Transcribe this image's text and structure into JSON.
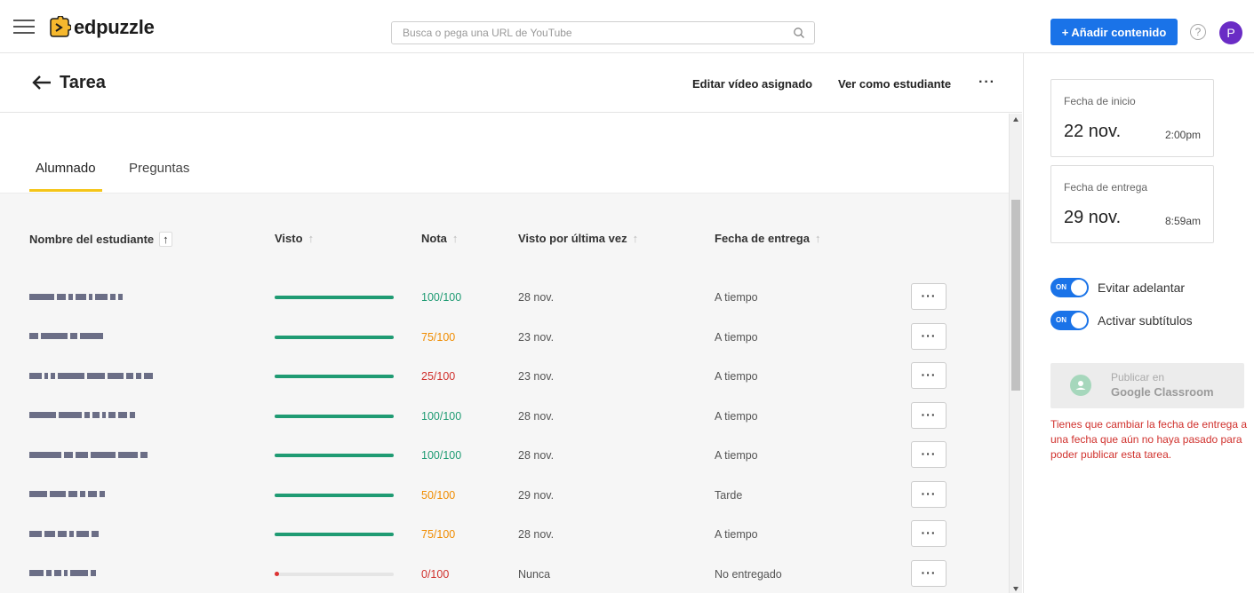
{
  "app": {
    "name": "edpuzzle"
  },
  "search": {
    "placeholder": "Busca o pega una URL de YouTube"
  },
  "header": {
    "add_button": "+ Añadir contenido",
    "help": "?",
    "avatar_initial": "P"
  },
  "page": {
    "title": "Tarea",
    "edit_link": "Editar vídeo asignado",
    "student_view_link": "Ver como estudiante",
    "more": "···"
  },
  "tabs": [
    {
      "label": "Alumnado"
    },
    {
      "label": "Preguntas"
    }
  ],
  "table": {
    "columns": [
      {
        "label": "Nombre del estudiante"
      },
      {
        "label": "Visto"
      },
      {
        "label": "Nota"
      },
      {
        "label": "Visto por última vez"
      },
      {
        "label": "Fecha de entrega"
      }
    ],
    "rows": [
      {
        "progress": 1.0,
        "grade": "100/100",
        "grade_color": "#1f9b73",
        "last_seen": "28 nov.",
        "delivery": "A tiempo"
      },
      {
        "progress": 1.0,
        "grade": "75/100",
        "grade_color": "#f08c00",
        "last_seen": "23 nov.",
        "delivery": "A tiempo"
      },
      {
        "progress": 1.0,
        "grade": "25/100",
        "grade_color": "#d0312d",
        "last_seen": "23 nov.",
        "delivery": "A tiempo"
      },
      {
        "progress": 1.0,
        "grade": "100/100",
        "grade_color": "#1f9b73",
        "last_seen": "28 nov.",
        "delivery": "A tiempo"
      },
      {
        "progress": 1.0,
        "grade": "100/100",
        "grade_color": "#1f9b73",
        "last_seen": "28 nov.",
        "delivery": "A tiempo"
      },
      {
        "progress": 1.0,
        "grade": "50/100",
        "grade_color": "#f08c00",
        "last_seen": "29 nov.",
        "delivery": "Tarde"
      },
      {
        "progress": 1.0,
        "grade": "75/100",
        "grade_color": "#f08c00",
        "last_seen": "28 nov.",
        "delivery": "A tiempo"
      },
      {
        "progress": 0.0,
        "grade": "0/100",
        "grade_color": "#d0312d",
        "last_seen": "Nunca",
        "delivery": "No entregado"
      }
    ],
    "row_more": "···"
  },
  "side": {
    "start": {
      "label": "Fecha de inicio",
      "day": "22 nov.",
      "time": "2:00pm"
    },
    "due": {
      "label": "Fecha de entrega",
      "day": "29 nov.",
      "time": "8:59am"
    },
    "toggles": [
      {
        "label": "Evitar adelantar",
        "state": "ON"
      },
      {
        "label": "Activar subtítulos",
        "state": "ON"
      }
    ],
    "classroom": {
      "line1": "Publicar en",
      "line2": "Google Classroom"
    },
    "warning": "Tienes que cambiar la fecha de entrega a una fecha que aún no haya pasado para poder publicar esta tarea."
  },
  "colors": {
    "accent": "#1a73e8",
    "progress": "#1f9b73",
    "tab_underline": "#f5c518",
    "warning": "#d0312d"
  }
}
